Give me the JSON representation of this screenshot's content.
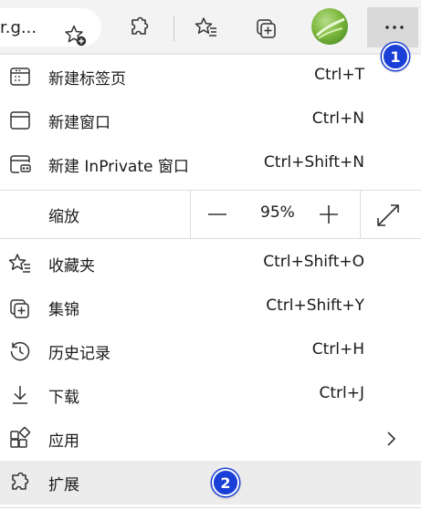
{
  "toolbar": {
    "address_fragment": "r.g...",
    "icons": [
      "star-add-icon",
      "puzzle-icon",
      "favorites-icon",
      "collections-icon",
      "profile-avatar",
      "more-icon"
    ]
  },
  "menu": {
    "items": [
      {
        "label": "新建标签页",
        "shortcut": "Ctrl+T",
        "icon": "new-tab-icon"
      },
      {
        "label": "新建窗口",
        "shortcut": "Ctrl+N",
        "icon": "new-window-icon"
      },
      {
        "label": "新建 InPrivate 窗口",
        "shortcut": "Ctrl+Shift+N",
        "icon": "inprivate-icon"
      }
    ],
    "zoom": {
      "label": "缩放",
      "minus": "—",
      "value": "95%",
      "plus": "+",
      "fullscreen_icon": "fullscreen-icon"
    },
    "items2": [
      {
        "label": "收藏夹",
        "shortcut": "Ctrl+Shift+O",
        "icon": "favorites-icon"
      },
      {
        "label": "集锦",
        "shortcut": "Ctrl+Shift+Y",
        "icon": "collections-icon"
      },
      {
        "label": "历史记录",
        "shortcut": "Ctrl+H",
        "icon": "history-icon"
      },
      {
        "label": "下载",
        "shortcut": "Ctrl+J",
        "icon": "download-icon"
      },
      {
        "label": "应用",
        "shortcut": "",
        "icon": "apps-icon",
        "submenu_icon": "chevron-right-icon"
      },
      {
        "label": "扩展",
        "shortcut": "",
        "icon": "extensions-icon"
      }
    ]
  },
  "badges": {
    "one": "1",
    "two": "2",
    "color": "#1a3fd6"
  }
}
